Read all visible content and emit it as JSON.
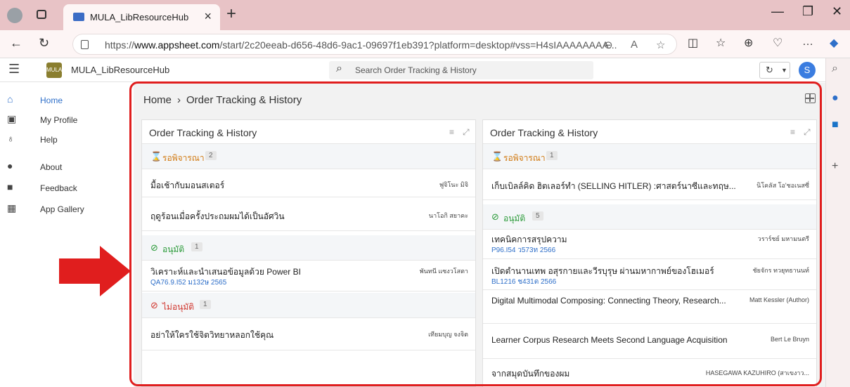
{
  "browser": {
    "tab_title": "MULA_LibResourceHub",
    "url_prefix": "https://",
    "url_host": "www.appsheet.com",
    "url_rest": "/start/2c20eeab-d656-48d6-9ac1-09697f1eb391?platform=desktop#vss=H4sIAAAAAAAA..."
  },
  "app": {
    "name": "MULA_LibResourceHub",
    "logo_text": "MULA",
    "search_placeholder": "Search Order Tracking & History",
    "avatar_letter": "S"
  },
  "nav": {
    "items": [
      {
        "label": "Home",
        "icon": "home-icon"
      },
      {
        "label": "My Profile",
        "icon": "profile-card-icon"
      },
      {
        "label": "Help",
        "icon": "lightbulb-icon"
      },
      {
        "label": "About",
        "icon": "info-icon"
      },
      {
        "label": "Feedback",
        "icon": "feedback-icon"
      },
      {
        "label": "App Gallery",
        "icon": "grid-icon"
      }
    ]
  },
  "breadcrumb": {
    "home": "Home",
    "current": "Order Tracking & History"
  },
  "left_panel": {
    "title": "Order Tracking & History",
    "groups": [
      {
        "label": "รอพิจารณา",
        "count": "2"
      },
      {
        "label": "อนุมัติ",
        "count": "1"
      },
      {
        "label": "ไม่อนุมัติ",
        "count": "1"
      }
    ],
    "rows": [
      {
        "title": "มื้อเช้ากับมอนสเตอร์",
        "author": "ฟูจิโนะ มิจิ"
      },
      {
        "title": "ฤดูร้อนเมื่อครั้งประถมผมได้เป็นอัศวิน",
        "author": "นาโอกิ สยาคะ"
      },
      {
        "title": "วิเคราะห์และนำเสนอข้อมูลด้วย Power BI",
        "sub": "QA76.9.I52 ม132ษ 2565",
        "author": "พันทนี แซงวโสตา"
      },
      {
        "title": "อย่าให้ใครใช้จิตวิทยาหลอกใช้คุณ",
        "author": "เทียมบุญ จงจิต"
      }
    ]
  },
  "right_panel": {
    "title": "Order Tracking & History",
    "groups": [
      {
        "label": "รอพิจารณา",
        "count": "1"
      },
      {
        "label": "อนุมัติ",
        "count": "5"
      }
    ],
    "rows": [
      {
        "title": "เก็บเบิลล์คิด ฮิตเลอร์ทำ (SELLING HITLER) :ศาสตร์นาซีและทฤษ...",
        "author": "นิโคลัส โอ'ชอเนสซี่"
      },
      {
        "title": "เทคนิคการสรุปความ",
        "sub": "P96.I54 ว573ท 2566",
        "author": "วราร์ชย์ มหามนตรี"
      },
      {
        "title": "เปิดตำนานเทพ อสุรกายและวีรบุรุษ ผ่านมหากาพย์ของโฮเมอร์",
        "sub": "BL1216 ช431ต 2566",
        "author": "ชัยจักร ทวยุทธานนท์"
      },
      {
        "title": "Digital Multimodal Composing: Connecting Theory, Research...",
        "author": "Matt Kessler (Author)"
      },
      {
        "title": "Learner Corpus Research Meets Second Language Acquisition",
        "author": "Bert Le Bruyn"
      },
      {
        "title": "จากสมุดบันทึกของผม",
        "author": "HASEGAWA KAZUHIRO (สาเขงาว..."
      }
    ]
  },
  "colors": {
    "pending": "#d17a12",
    "approved": "#2c9b3a",
    "rejected": "#d0342c",
    "accent": "#2e6fc9",
    "annotation": "#e01e1e"
  }
}
